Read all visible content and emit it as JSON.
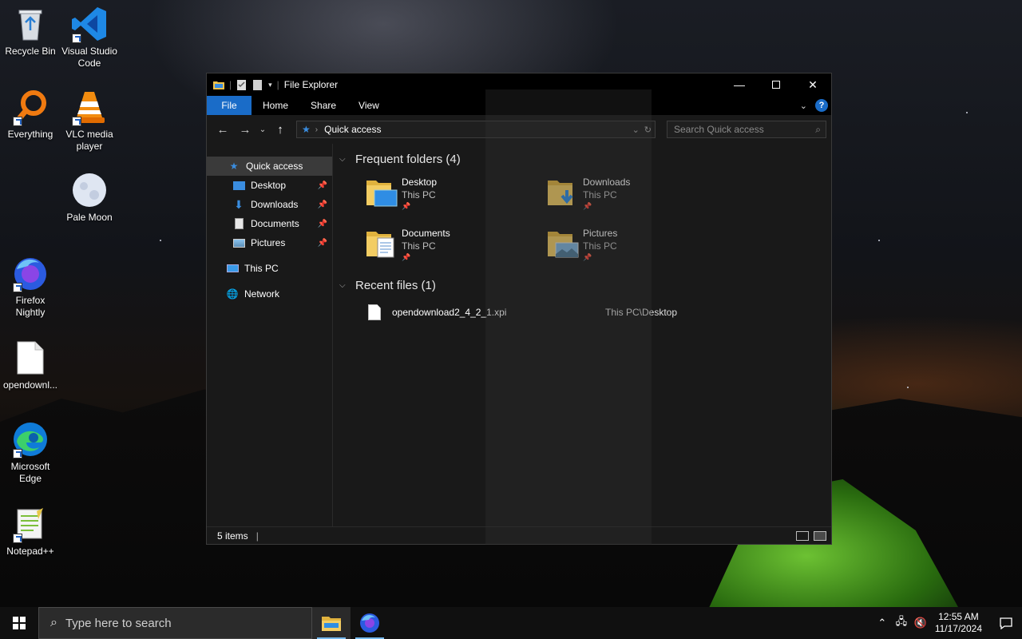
{
  "desktop": {
    "icons": [
      {
        "label": "Recycle Bin"
      },
      {
        "label": "Visual Studio Code"
      },
      {
        "label": "Everything"
      },
      {
        "label": "VLC media player"
      },
      {
        "label": "Pale Moon"
      },
      {
        "label": "Firefox Nightly"
      },
      {
        "label": "opendownl..."
      },
      {
        "label": "Microsoft Edge"
      },
      {
        "label": "Notepad++"
      }
    ]
  },
  "explorer": {
    "title": "File Explorer",
    "ribbon_tabs": [
      "File",
      "Home",
      "Share",
      "View"
    ],
    "help_label": "?",
    "address": {
      "location": "Quick access"
    },
    "search": {
      "placeholder": "Search Quick access"
    },
    "nav_pane": {
      "quick_access": "Quick access",
      "pinned": [
        "Desktop",
        "Downloads",
        "Documents",
        "Pictures"
      ],
      "this_pc": "This PC",
      "network": "Network"
    },
    "frequent_folders": {
      "header": "Frequent folders (4)",
      "items": [
        {
          "name": "Desktop",
          "location": "This PC"
        },
        {
          "name": "Downloads",
          "location": "This PC"
        },
        {
          "name": "Documents",
          "location": "This PC"
        },
        {
          "name": "Pictures",
          "location": "This PC"
        }
      ]
    },
    "recent_files": {
      "header": "Recent files (1)",
      "items": [
        {
          "name": "opendownload2_4_2_1.xpi",
          "path": "This PC\\Desktop"
        }
      ]
    },
    "status": {
      "items_count": "5 items"
    }
  },
  "taskbar": {
    "search_placeholder": "Type here to search",
    "time": "12:55 AM",
    "date": "11/17/2024"
  },
  "colors": {
    "accent": "#1a6cc8",
    "window_bg": "#191919",
    "titlebar_bg": "#000000",
    "folder_yellow": "#f0c24a"
  }
}
